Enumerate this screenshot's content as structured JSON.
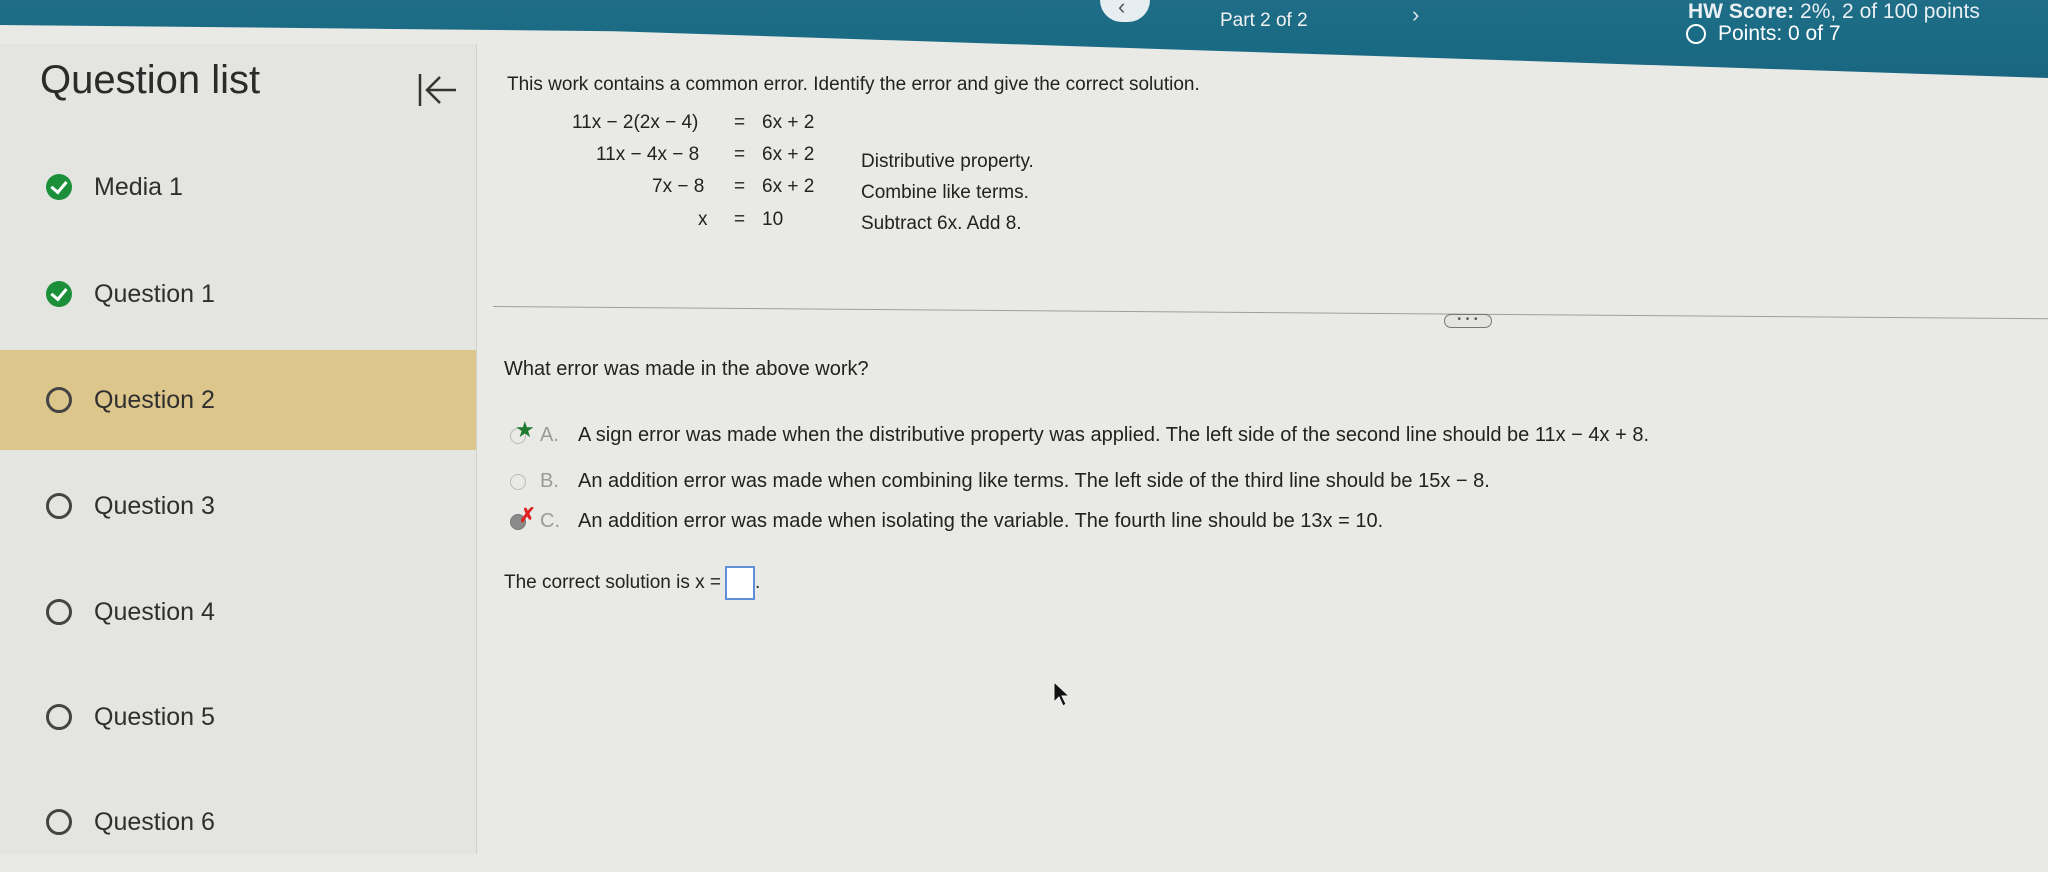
{
  "header": {
    "part_label": "Part 2 of 2",
    "prev_icon": "chevron-left-icon",
    "prev_glyph": "‹",
    "next_glyph": "›",
    "hw_score_label": "HW Score:",
    "hw_score_value": "2%, 2 of 100 points",
    "points_label": "Points: 0 of 7"
  },
  "sidebar": {
    "title": "Question list",
    "items": [
      {
        "label": "Media 1",
        "status": "done"
      },
      {
        "label": "Question 1",
        "status": "done"
      },
      {
        "label": "Question 2",
        "status": "open",
        "active": true
      },
      {
        "label": "Question 3",
        "status": "open"
      },
      {
        "label": "Question 4",
        "status": "open"
      },
      {
        "label": "Question 5",
        "status": "open"
      },
      {
        "label": "Question 6",
        "status": "open"
      }
    ]
  },
  "problem": {
    "prompt": "This work contains a common error. Identify the error and give the correct solution.",
    "work_lines": [
      {
        "lhs": "11x − 2(2x − 4)",
        "rhs": "6x + 2",
        "note": ""
      },
      {
        "lhs": "11x − 4x − 8",
        "rhs": "6x + 2",
        "note": "Distributive property."
      },
      {
        "lhs": "7x − 8",
        "rhs": "6x + 2",
        "note": "Combine like terms."
      },
      {
        "lhs": "x",
        "rhs": "10",
        "note": "Subtract 6x. Add 8."
      }
    ],
    "more_label": "• • •",
    "question": "What error was made in the above work?",
    "options": [
      {
        "letter": "A.",
        "text": "A sign error was made when the distributive property was applied. The left side of the second line should be 11x − 4x + 8.",
        "marker": "correct"
      },
      {
        "letter": "B.",
        "text": "An addition error was made when combining like terms. The left side of the third line should be 15x − 8.",
        "marker": "none"
      },
      {
        "letter": "C.",
        "text": "An addition error was made when isolating the variable. The fourth line should be 13x = 10.",
        "marker": "incorrect"
      }
    ],
    "solution_label": "The correct solution is x =",
    "solution_period": ".",
    "answer_value": ""
  }
}
